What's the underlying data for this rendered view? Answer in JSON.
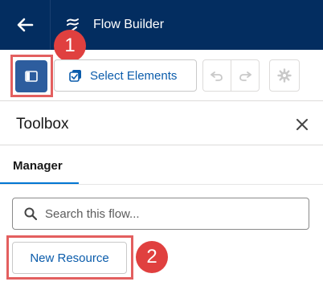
{
  "header": {
    "app_title": "Flow Builder",
    "back_icon": "arrow-left-icon",
    "app_icon": "flow-icon"
  },
  "toolbar": {
    "select_elements_label": "Select Elements",
    "toggle_icon": "toggle-panel-icon",
    "select_icon": "multi-select-icon",
    "undo_icon": "undo-icon",
    "redo_icon": "redo-icon",
    "settings_icon": "gear-icon"
  },
  "annotations": {
    "callout_1": "1",
    "callout_2": "2",
    "callout_color": "#e0403f"
  },
  "toolbox": {
    "title": "Toolbox",
    "close_icon": "close-icon",
    "tabs": [
      {
        "label": "Manager",
        "active": true
      }
    ],
    "search": {
      "placeholder": "Search this flow...",
      "value": ""
    },
    "new_resource_label": "New Resource"
  },
  "colors": {
    "header_bg": "#032d60",
    "brand_blue": "#0b5cab",
    "tab_accent": "#0176d3"
  }
}
